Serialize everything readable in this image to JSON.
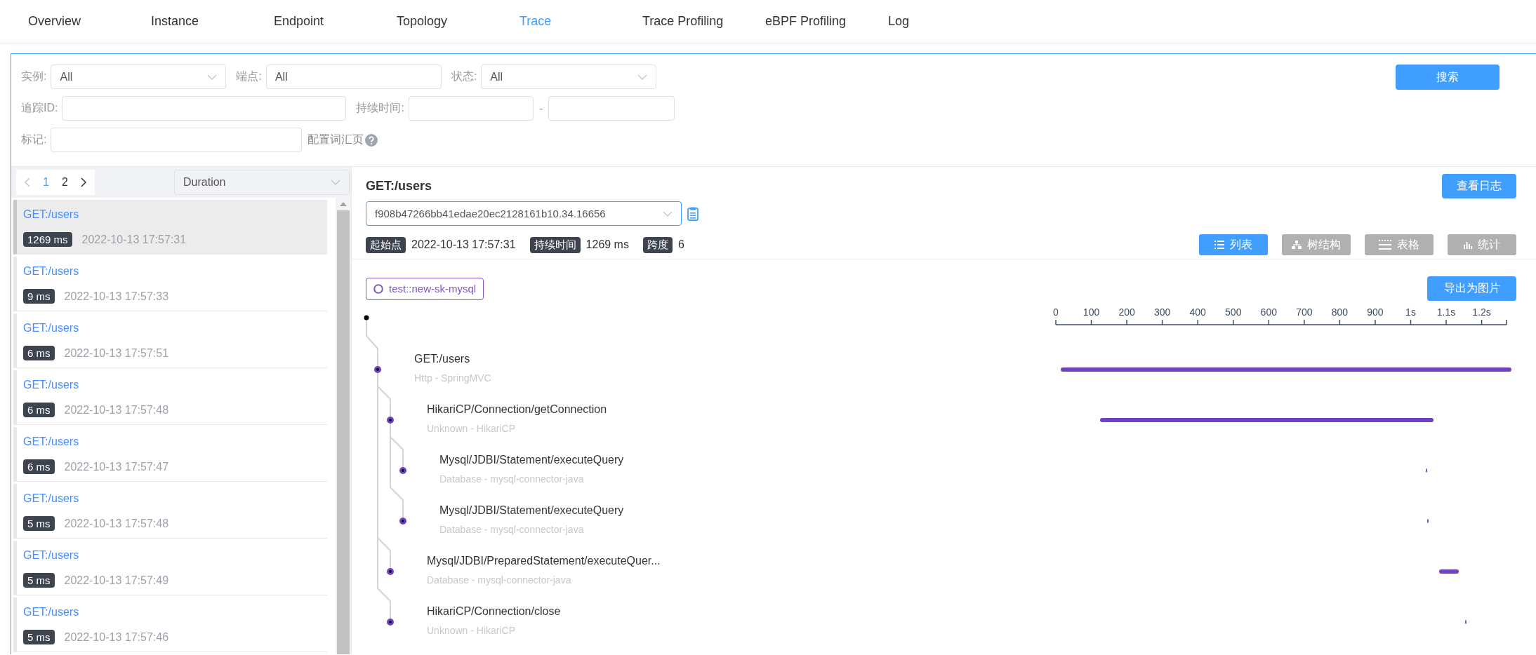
{
  "nav": {
    "tabs": [
      {
        "label": "Overview",
        "selected": false
      },
      {
        "label": "Instance",
        "selected": false
      },
      {
        "label": "Endpoint",
        "selected": false
      },
      {
        "label": "Topology",
        "selected": false
      },
      {
        "label": "Trace",
        "selected": true
      },
      {
        "label": "Trace Profiling",
        "selected": false
      },
      {
        "label": "eBPF Profiling",
        "selected": false
      },
      {
        "label": "Log",
        "selected": false
      }
    ]
  },
  "filters": {
    "instance": {
      "label": "实例:",
      "value": "All"
    },
    "endpoint": {
      "label": "端点:",
      "value": "All"
    },
    "status": {
      "label": "状态:",
      "value": "All"
    },
    "trace_id": {
      "label": "追踪ID:"
    },
    "duration": {
      "label": "持续时间:",
      "separator": "-"
    },
    "tags": {
      "label": "标记:",
      "link": "配置词汇页"
    },
    "search_button": "搜索"
  },
  "trace_list": {
    "pages": [
      {
        "label": "1",
        "selected": true
      },
      {
        "label": "2",
        "selected": false
      }
    ],
    "sort": "Duration",
    "items": [
      {
        "name": "GET:/users",
        "duration": "1269 ms",
        "time": "2022-10-13 17:57:31",
        "selected": true
      },
      {
        "name": "GET:/users",
        "duration": "9 ms",
        "time": "2022-10-13 17:57:33",
        "selected": false
      },
      {
        "name": "GET:/users",
        "duration": "6 ms",
        "time": "2022-10-13 17:57:51",
        "selected": false
      },
      {
        "name": "GET:/users",
        "duration": "6 ms",
        "time": "2022-10-13 17:57:48",
        "selected": false
      },
      {
        "name": "GET:/users",
        "duration": "6 ms",
        "time": "2022-10-13 17:57:47",
        "selected": false
      },
      {
        "name": "GET:/users",
        "duration": "5 ms",
        "time": "2022-10-13 17:57:48",
        "selected": false
      },
      {
        "name": "GET:/users",
        "duration": "5 ms",
        "time": "2022-10-13 17:57:49",
        "selected": false
      },
      {
        "name": "GET:/users",
        "duration": "5 ms",
        "time": "2022-10-13 17:57:46",
        "selected": false
      }
    ]
  },
  "trace_detail": {
    "title": "GET:/users",
    "logs_button": "查看日志",
    "trace_id": "f908b47266bb41edae20ec2128161b10.34.16656",
    "meta": [
      {
        "label": "起始点",
        "value": "2022-10-13 17:57:31"
      },
      {
        "label": "持续时间",
        "value": "1269 ms"
      },
      {
        "label": "跨度",
        "value": "6"
      }
    ],
    "views": [
      {
        "label": "列表",
        "kind": "list",
        "selected": true
      },
      {
        "label": "树结构",
        "kind": "tree",
        "selected": false
      },
      {
        "label": "表格",
        "kind": "table",
        "selected": false
      },
      {
        "label": "统计",
        "kind": "stats",
        "selected": false
      }
    ],
    "service": "test::new-sk-mysql",
    "export_button": "导出为图片",
    "spans": [
      {
        "name": "GET:/users",
        "type": "Http - SpringMVC",
        "children": [
          {
            "name": "HikariCP/Connection/getConnection",
            "type": "Unknown - HikariCP",
            "children": [
              {
                "name": "Mysql/JDBI/Statement/executeQuery",
                "type": "Database - mysql-connector-java"
              },
              {
                "name": "Mysql/JDBI/Statement/executeQuery",
                "type": "Database - mysql-connector-java"
              }
            ]
          },
          {
            "name": "Mysql/JDBI/PreparedStatement/executeQuer...",
            "type": "Database - mysql-connector-java"
          },
          {
            "name": "HikariCP/Connection/close",
            "type": "Unknown - HikariCP"
          }
        ]
      }
    ],
    "timeline_axis": [
      "0",
      "100",
      "200",
      "300",
      "400",
      "500",
      "600",
      "700",
      "800",
      "900",
      "1s",
      "1.1s",
      "1.2s"
    ]
  }
}
